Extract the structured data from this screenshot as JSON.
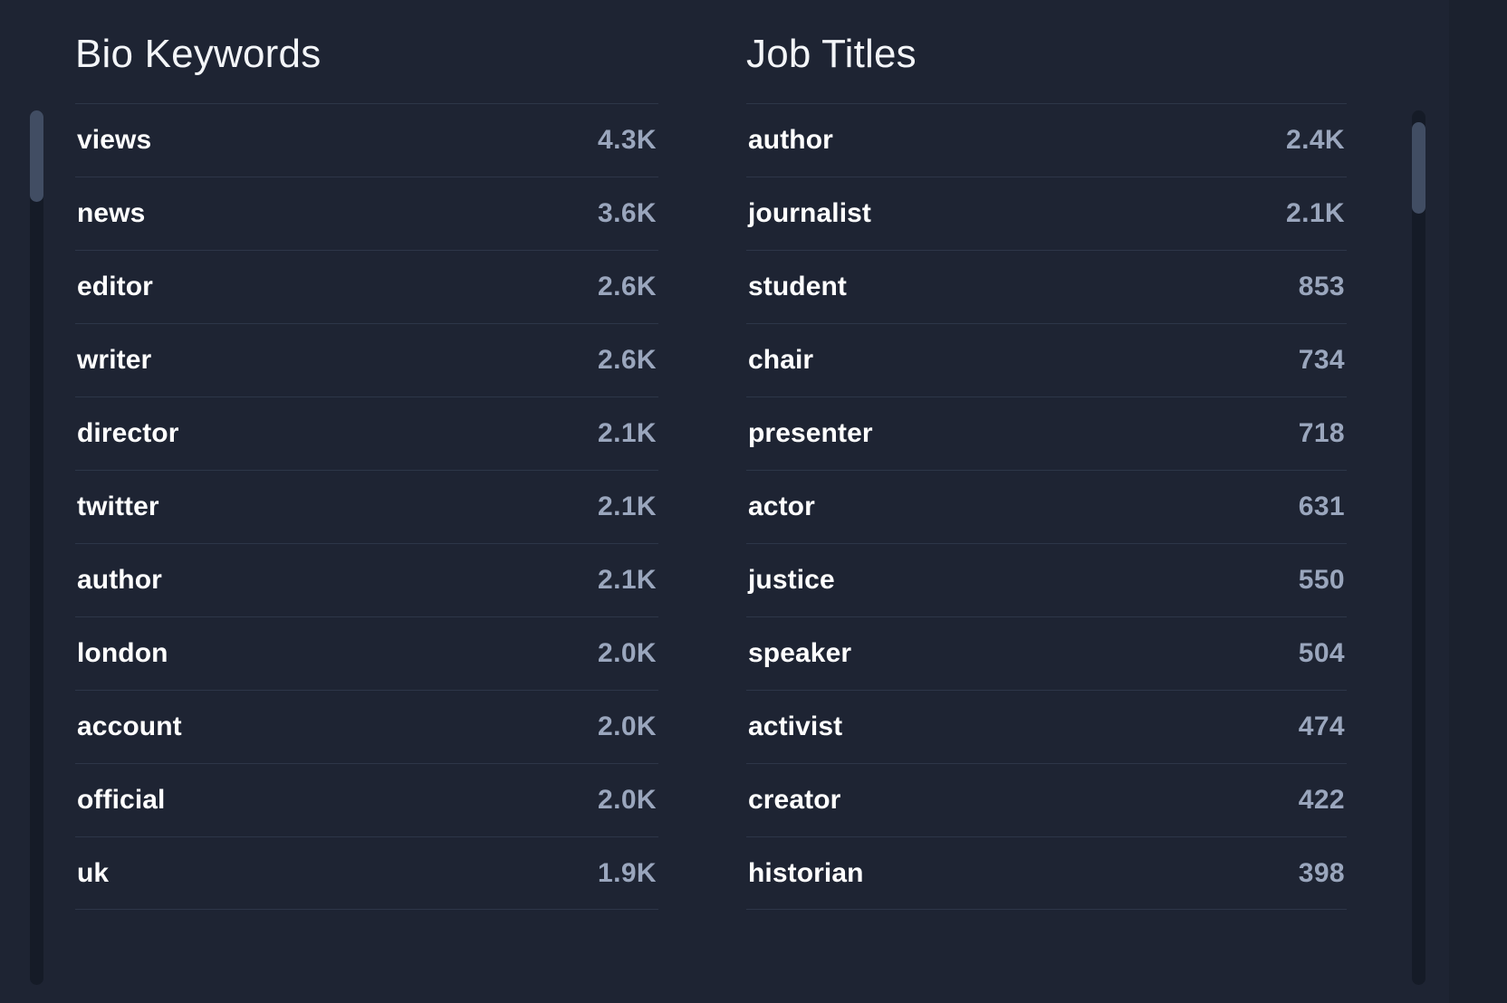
{
  "theme": {
    "page_background": "#1b212e",
    "panel_background": "#1e2433",
    "divider": "#2d3648",
    "label_color": "#ffffff",
    "value_color": "#9aa6bd",
    "scrollbar_track": "#151b27",
    "scrollbar_thumb": "#414d63"
  },
  "panels": [
    {
      "title": "Bio Keywords",
      "rows": [
        {
          "label": "views",
          "value": "4.3K"
        },
        {
          "label": "news",
          "value": "3.6K"
        },
        {
          "label": "editor",
          "value": "2.6K"
        },
        {
          "label": "writer",
          "value": "2.6K"
        },
        {
          "label": "director",
          "value": "2.1K"
        },
        {
          "label": "twitter",
          "value": "2.1K"
        },
        {
          "label": "author",
          "value": "2.1K"
        },
        {
          "label": "london",
          "value": "2.0K"
        },
        {
          "label": "account",
          "value": "2.0K"
        },
        {
          "label": "official",
          "value": "2.0K"
        },
        {
          "label": "uk",
          "value": "1.9K"
        }
      ]
    },
    {
      "title": "Job Titles",
      "rows": [
        {
          "label": "author",
          "value": "2.4K"
        },
        {
          "label": "journalist",
          "value": "2.1K"
        },
        {
          "label": "student",
          "value": "853"
        },
        {
          "label": "chair",
          "value": "734"
        },
        {
          "label": "presenter",
          "value": "718"
        },
        {
          "label": "actor",
          "value": "631"
        },
        {
          "label": "justice",
          "value": "550"
        },
        {
          "label": "speaker",
          "value": "504"
        },
        {
          "label": "activist",
          "value": "474"
        },
        {
          "label": "creator",
          "value": "422"
        },
        {
          "label": "historian",
          "value": "398"
        }
      ]
    }
  ]
}
